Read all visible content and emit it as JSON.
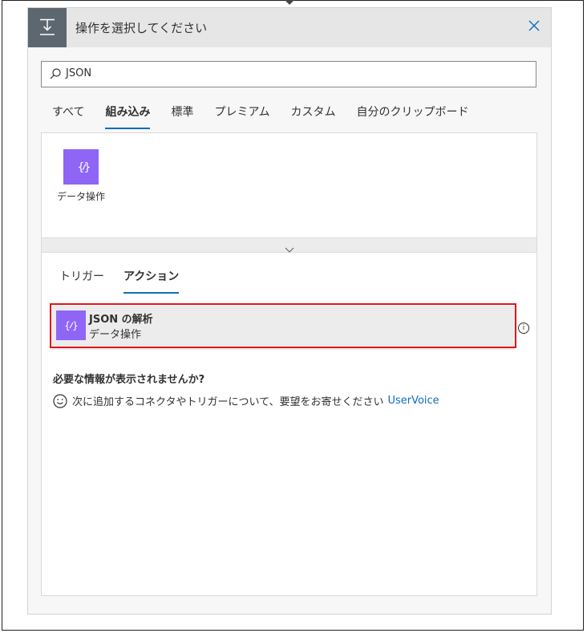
{
  "header": {
    "title": "操作を選択してください",
    "close_label": "✕"
  },
  "search": {
    "value": "JSON"
  },
  "tabs": [
    {
      "label": "すべて",
      "active": false
    },
    {
      "label": "組み込み",
      "active": true
    },
    {
      "label": "標準",
      "active": false
    },
    {
      "label": "プレミアム",
      "active": false
    },
    {
      "label": "カスタム",
      "active": false
    },
    {
      "label": "自分のクリップボード",
      "active": false
    }
  ],
  "connector": {
    "label": "データ操作",
    "icon": "curly-braces-icon",
    "color": "#8f65f6"
  },
  "subtabs": [
    {
      "label": "トリガー",
      "active": false
    },
    {
      "label": "アクション",
      "active": true
    }
  ],
  "action": {
    "title": "JSON の解析",
    "subtitle": "データ操作"
  },
  "missing": {
    "title": "必要な情報が表示されませんか?",
    "text": "次に追加するコネクタやトリガーについて、要望をお寄せください",
    "link": "UserVoice"
  },
  "colors": {
    "accent": "#0f6cbd",
    "connector": "#8f65f6",
    "highlight": "#e3141b"
  }
}
